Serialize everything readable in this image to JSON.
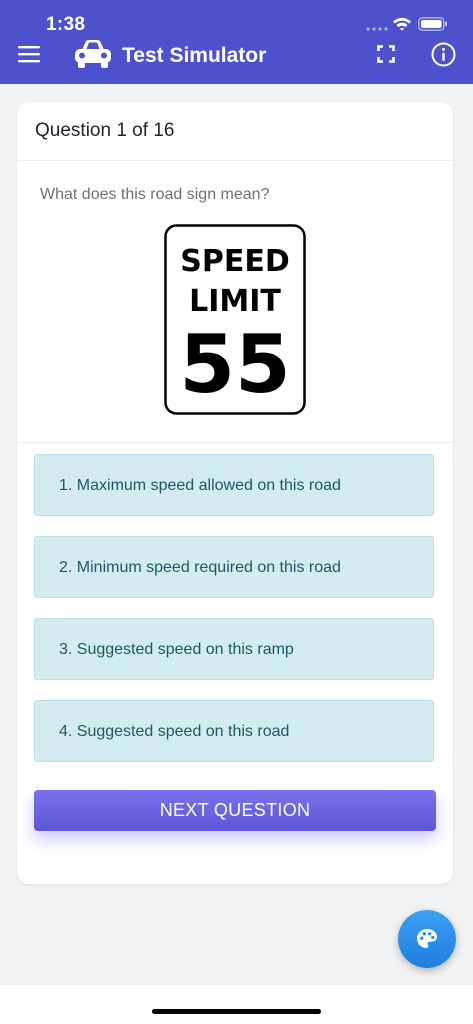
{
  "status_bar": {
    "time": "1:38"
  },
  "header": {
    "title": "Test Simulator",
    "icons": [
      "menu-icon",
      "car-icon",
      "fullscreen-icon",
      "info-icon"
    ]
  },
  "question": {
    "counter": "Question 1 of 16",
    "text": "What does this road sign mean?",
    "sign": {
      "line1": "SPEED",
      "line2": "LIMIT",
      "number": "55"
    }
  },
  "answers": [
    {
      "label": "1. Maximum speed allowed on this road"
    },
    {
      "label": "2. Minimum speed required on this road"
    },
    {
      "label": "3. Suggested speed on this ramp"
    },
    {
      "label": "4. Suggested speed on this road"
    }
  ],
  "actions": {
    "next_label": "NEXT QUESTION"
  },
  "fab": {
    "icon": "palette-icon"
  },
  "colors": {
    "header": "#4d52cc",
    "answer_bg": "#d2ecf0",
    "answer_text": "#1d5866",
    "button": "#6a65e2",
    "fab": "#2f8fea"
  }
}
